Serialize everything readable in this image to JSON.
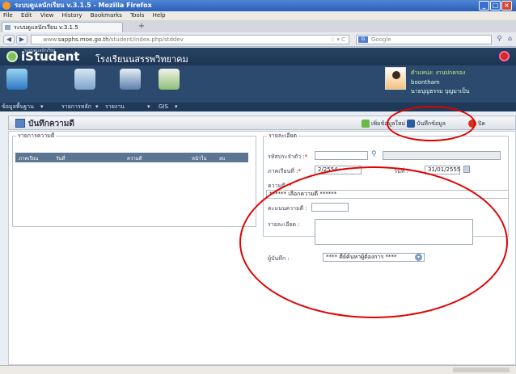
{
  "browser": {
    "title": "ระบบดูแลนักเรียน v.3.1.5 - Mozilla Firefox",
    "menu": [
      "File",
      "Edit",
      "View",
      "History",
      "Bookmarks",
      "Tools",
      "Help"
    ],
    "tab": "ระบบดูแลนักเรียน v.3.1.5",
    "url_prefix": "www.",
    "url_host": "sapphs.moe.go.th",
    "url_path": "/student/index.php/stddev",
    "search_placeholder": "Google",
    "nav_refresh": "C"
  },
  "app": {
    "logo_sub": "ระบบดูแลนักเรียน",
    "logo": "iStudent",
    "school": "โรงเรียนนสรรพวิทยาคม",
    "user": {
      "role": "ตำแหน่ง: งานปกครอง",
      "login": "boontham",
      "name": "นายบุญธรรม บุญมาเป็น"
    },
    "modules": [
      "ข้อมูลพื้นฐาน",
      "รายการหลัก",
      "รายงาน",
      "GIS"
    ]
  },
  "page": {
    "title": "บันทึกความดี",
    "toolbar": {
      "new": "เพิ่มข้อมูลใหม่",
      "save": "บันทึกข้อมูล",
      "close": "ปิด"
    }
  },
  "list": {
    "legend": "รายการความดี",
    "columns": [
      "ภาคเรียน",
      "วันที่",
      "ความดี",
      "หน้าใน",
      "ลบ"
    ]
  },
  "detail": {
    "legend": "รายละเอียด",
    "student_id_label": "รหัสประจำตัว :",
    "term_label": "ภาคเรียนที่ :",
    "term_value": "2/2554",
    "date_label": "วันที่ :",
    "date_value": "31/01/2555",
    "goodness_label": "ความดี :",
    "goodness_placeholder": "****** เลือกความดี ******",
    "score_label": "คะแนนความดี :",
    "detail_label": "รายละเอียด :",
    "recorder_label": "ผู้บันทึก :",
    "recorder_value": "**** คีย์ค้นหาผู้ต้องการ ****"
  }
}
